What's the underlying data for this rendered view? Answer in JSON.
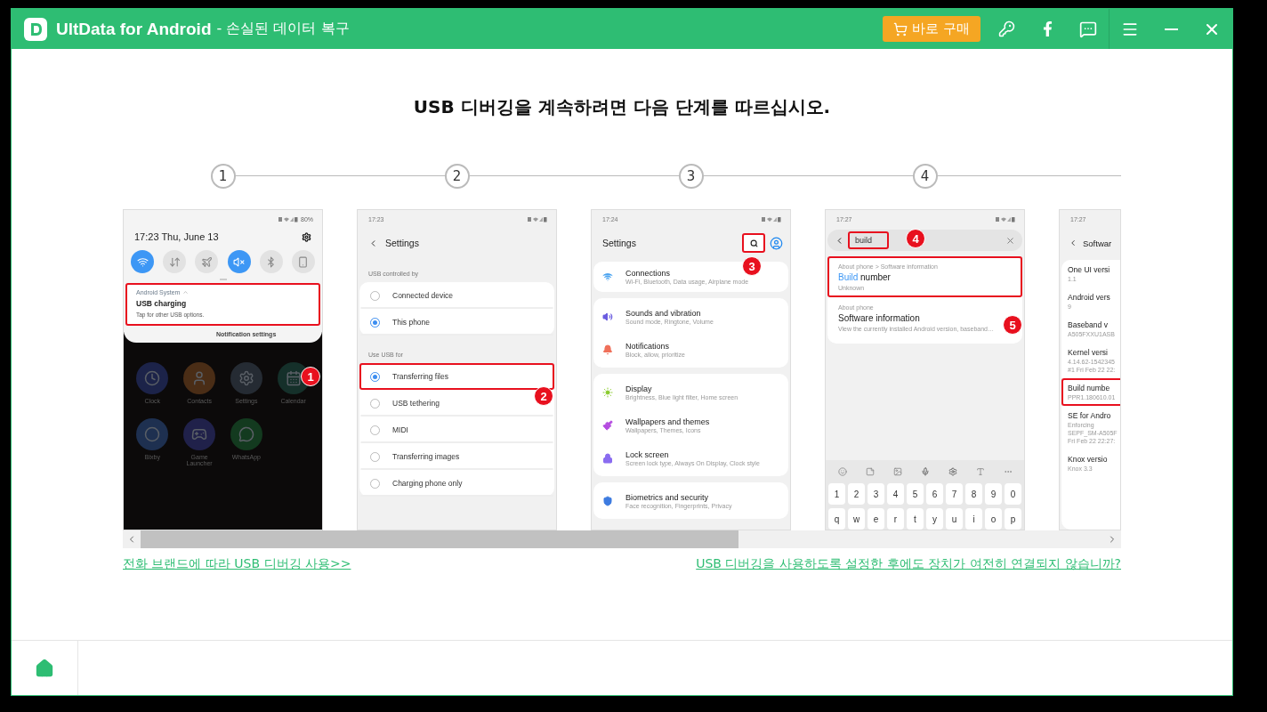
{
  "app": {
    "name": "UltData for Android",
    "subtitle": "- 손실된 데이터 복구",
    "buy_label": "바로 구매"
  },
  "heading": "USB 디버깅을 계속하려면 다음 단계를 따르십시오.",
  "steps": [
    "1",
    "2",
    "3",
    "4"
  ],
  "panels": [
    {
      "kind": "notification_shade",
      "battery": "80%",
      "time": "17:23",
      "date": "Thu, June 13",
      "badge": "1",
      "toggles": [
        {
          "kind": "wifi",
          "on": true
        },
        {
          "kind": "data",
          "on": false
        },
        {
          "kind": "airplane",
          "on": false
        },
        {
          "kind": "mute",
          "on": true
        },
        {
          "kind": "bluetooth",
          "on": false
        },
        {
          "kind": "rotate",
          "on": false
        }
      ],
      "notification": {
        "app": "Android System",
        "title": "USB charging",
        "text": "Tap for other USB options.",
        "action": "Notification settings",
        "highlighted": true
      },
      "apps": [
        {
          "kind": "clock",
          "label": "Clock",
          "color": "#1c2349"
        },
        {
          "kind": "contacts",
          "label": "Contacts",
          "color": "#4a2d16"
        },
        {
          "kind": "settings",
          "label": "Settings",
          "color": "#252b33"
        },
        {
          "kind": "calendar",
          "label": "Calendar",
          "color": "#15302a"
        },
        {
          "kind": "bixby",
          "label": "Bixby",
          "color": "#1e3050"
        },
        {
          "kind": "game",
          "label": "Game Launcher",
          "color": "#20214a"
        },
        {
          "kind": "whatsapp",
          "label": "WhatsApp",
          "color": "#133a1f"
        }
      ]
    },
    {
      "kind": "usb_settings",
      "time": "17:23",
      "title": "Settings",
      "badge": "2",
      "groups": [
        {
          "label": "USB controlled by",
          "options": [
            {
              "label": "Connected device",
              "selected": false,
              "highlighted": false
            },
            {
              "label": "This phone",
              "selected": true,
              "highlighted": false
            }
          ]
        },
        {
          "label": "Use USB for",
          "options": [
            {
              "label": "Transferring files",
              "selected": true,
              "highlighted": true
            },
            {
              "label": "USB tethering",
              "selected": false,
              "highlighted": false
            },
            {
              "label": "MIDI",
              "selected": false,
              "highlighted": false
            },
            {
              "label": "Transferring images",
              "selected": false,
              "highlighted": false
            },
            {
              "label": "Charging phone only",
              "selected": false,
              "highlighted": false
            }
          ]
        }
      ]
    },
    {
      "kind": "settings_menu",
      "time": "17:24",
      "title": "Settings",
      "badge": "3",
      "groups": [
        {
          "items": [
            {
              "kind": "wifi",
              "color": "#4aa3f0",
              "title": "Connections",
              "subtitle": "Wi-Fi, Bluetooth, Data usage, Airplane mode"
            }
          ]
        },
        {
          "items": [
            {
              "kind": "speaker",
              "color": "#6a5ce0",
              "title": "Sounds and vibration",
              "subtitle": "Sound mode, Ringtone, Volume"
            },
            {
              "kind": "bell",
              "color": "#f0705a",
              "title": "Notifications",
              "subtitle": "Block, allow, prioritize"
            }
          ]
        },
        {
          "items": [
            {
              "kind": "sun",
              "color": "#8acb2e",
              "title": "Display",
              "subtitle": "Brightness, Blue light filter, Home screen"
            },
            {
              "kind": "brush",
              "color": "#b44be0",
              "title": "Wallpapers and themes",
              "subtitle": "Wallpapers, Themes, Icons"
            },
            {
              "kind": "lock",
              "color": "#8a6cf0",
              "title": "Lock screen",
              "subtitle": "Screen lock type, Always On Display, Clock style"
            }
          ]
        },
        {
          "items": [
            {
              "kind": "shield",
              "color": "#3d7be0",
              "title": "Biometrics and security",
              "subtitle": "Face recognition, Fingerprints, Privacy"
            }
          ]
        }
      ]
    },
    {
      "kind": "search_results",
      "time": "17:27",
      "query": "build",
      "query_badge": "4",
      "badge": "5",
      "results": [
        {
          "path": "About phone > Software information",
          "match": "Build",
          "title": "number",
          "subtitle": "Unknown",
          "highlighted": true
        },
        {
          "path": "About phone",
          "title": "Software information",
          "subtitle": "View the currently installed Android version, baseband…",
          "highlighted": false
        }
      ],
      "keys": [
        [
          "1",
          "2",
          "3",
          "4",
          "5",
          "6",
          "7",
          "8",
          "9",
          "0"
        ],
        [
          "q",
          "w",
          "e",
          "r",
          "t",
          "y",
          "u",
          "i",
          "o",
          "p"
        ]
      ]
    },
    {
      "kind": "software_info",
      "time": "17:27",
      "title": "Softwar",
      "items": [
        {
          "title": "One UI versi",
          "lines": [
            "1.1"
          ],
          "highlighted": false
        },
        {
          "title": "Android vers",
          "lines": [
            "9"
          ],
          "highlighted": false
        },
        {
          "title": "Baseband v",
          "lines": [
            "A505FXXU1ASB"
          ],
          "highlighted": false
        },
        {
          "title": "Kernel versi",
          "lines": [
            "4.14.62-1542345",
            "#1 Fri Feb 22 22:"
          ],
          "highlighted": false
        },
        {
          "title": "Build numbe",
          "lines": [
            "PPR1.180610.01"
          ],
          "highlighted": true
        },
        {
          "title": "SE for Andro",
          "lines": [
            "Enforcing",
            "SEPF_SM-A505F",
            "Fri Feb 22 22:27:"
          ],
          "highlighted": false
        },
        {
          "title": "Knox versio",
          "lines": [
            "Knox 3.3"
          ],
          "highlighted": false
        }
      ]
    }
  ],
  "links": [
    "전화 브랜드에 따라 USB 디버깅 사용>>",
    "USB 디버깅을 사용하도록 설정한 후에도 장치가 여전히 연결되지 않습니까?"
  ]
}
